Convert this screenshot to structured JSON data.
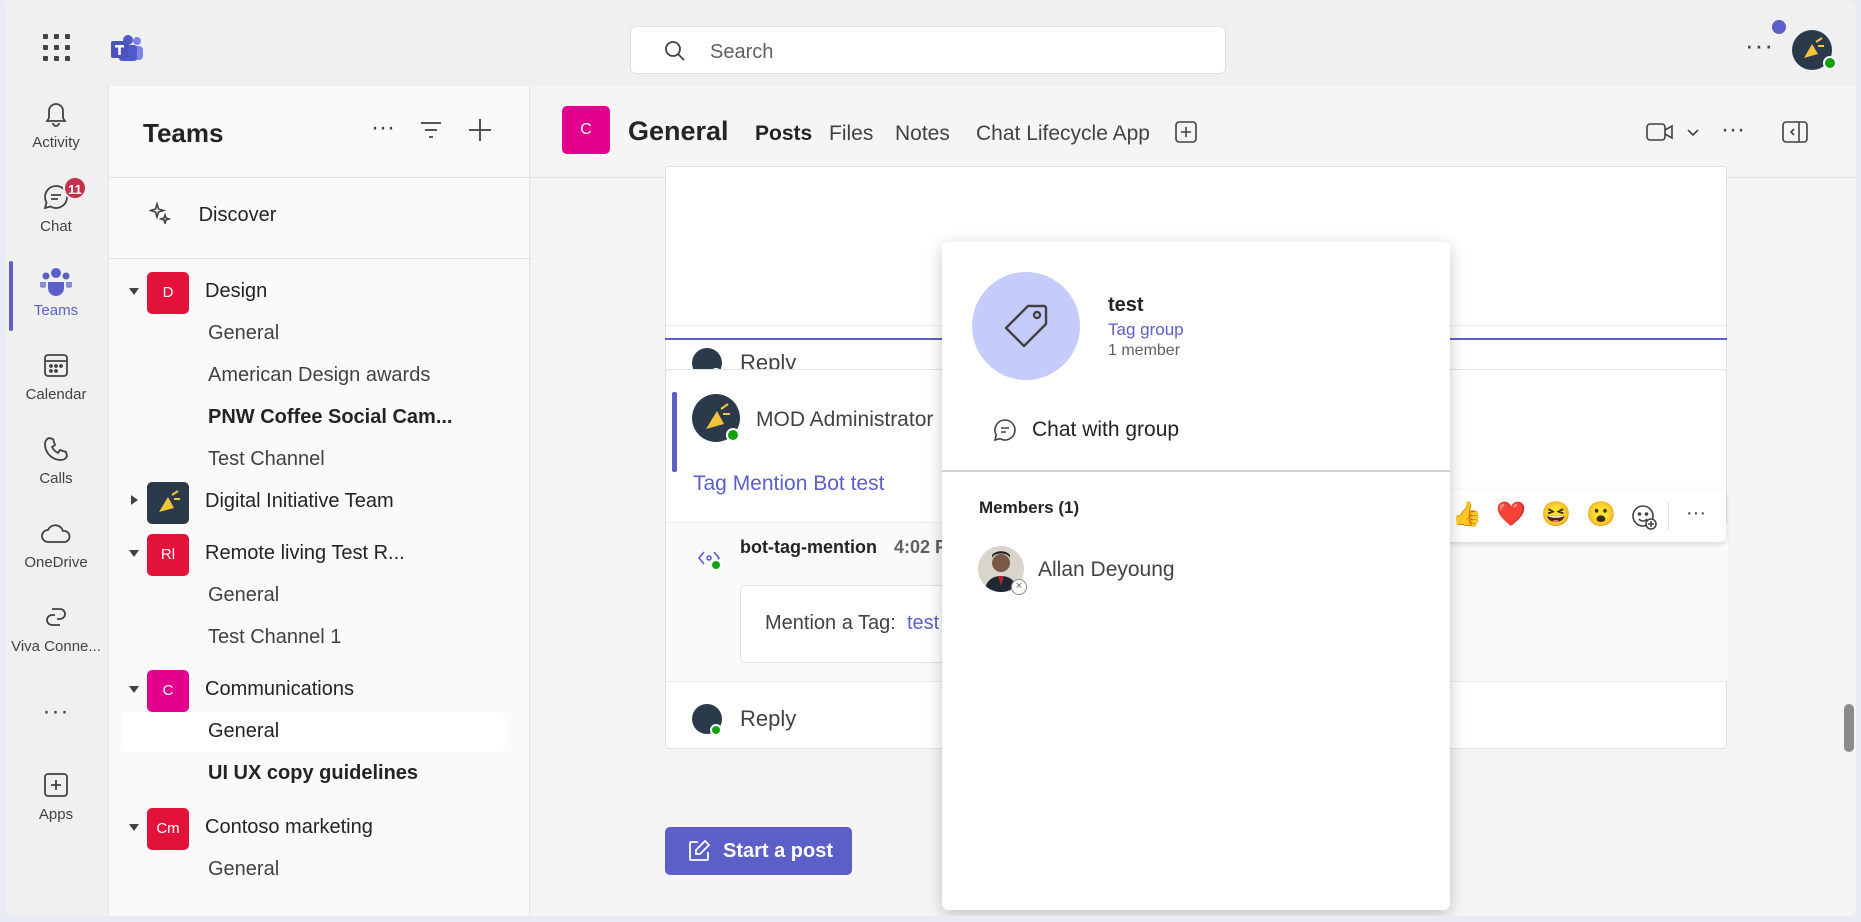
{
  "topbar": {
    "search_placeholder": "Search",
    "more": "···"
  },
  "rail": {
    "items": [
      {
        "label": "Activity",
        "icon": "bell-icon"
      },
      {
        "label": "Chat",
        "icon": "chat-icon",
        "badge": "11"
      },
      {
        "label": "Teams",
        "icon": "teams-icon"
      },
      {
        "label": "Calendar",
        "icon": "calendar-icon"
      },
      {
        "label": "Calls",
        "icon": "phone-icon"
      },
      {
        "label": "OneDrive",
        "icon": "cloud-icon"
      },
      {
        "label": "Viva Conne...",
        "icon": "viva-icon"
      },
      {
        "label": "···",
        "icon": "more-icon"
      },
      {
        "label": "Apps",
        "icon": "apps-icon"
      }
    ]
  },
  "panel": {
    "title": "Teams",
    "discover": "Discover",
    "teams": [
      {
        "name": "Design",
        "initials": "D",
        "color": "#e3123a",
        "channels": [
          "General",
          "American Design awards",
          "PNW Coffee Social Cam...",
          "Test Channel"
        ]
      },
      {
        "name": "Digital Initiative Team",
        "initials": "",
        "color": "#2b3a4b",
        "channels": []
      },
      {
        "name": "Remote living Test R...",
        "initials": "Rl",
        "color": "#e3123a",
        "channels": [
          "General",
          "Test Channel 1"
        ]
      },
      {
        "name": "Communications",
        "initials": "C",
        "color": "#e3008c",
        "channels": [
          "General",
          "UI UX copy guidelines"
        ]
      },
      {
        "name": "Contoso marketing",
        "initials": "Cm",
        "color": "#e3123a",
        "channels": [
          "General"
        ]
      }
    ]
  },
  "channel": {
    "avatar": "C",
    "title": "General",
    "tabs": [
      "Posts",
      "Files",
      "Notes",
      "Chat Lifecycle App"
    ]
  },
  "feed": {
    "reply": "Reply",
    "author": "MOD Administrator",
    "post_title": "Tag Mention Bot test",
    "bot_name": "bot-tag-mention",
    "bot_time": "4:02 P",
    "mention_text": "Mention a Tag:",
    "mention_tag": "test",
    "start_post": "Start a post",
    "reactions": [
      "👍",
      "❤️",
      "😆",
      "😮"
    ]
  },
  "popup": {
    "name": "test",
    "type": "Tag group",
    "members_count": "1 member",
    "chat_button": "Chat with group",
    "members_header": "Members (1)",
    "members": [
      "Allan Deyoung"
    ]
  },
  "colors": {
    "accent": "#5b5fc7",
    "presence": "#13a10e",
    "badge": "#c4314b"
  }
}
